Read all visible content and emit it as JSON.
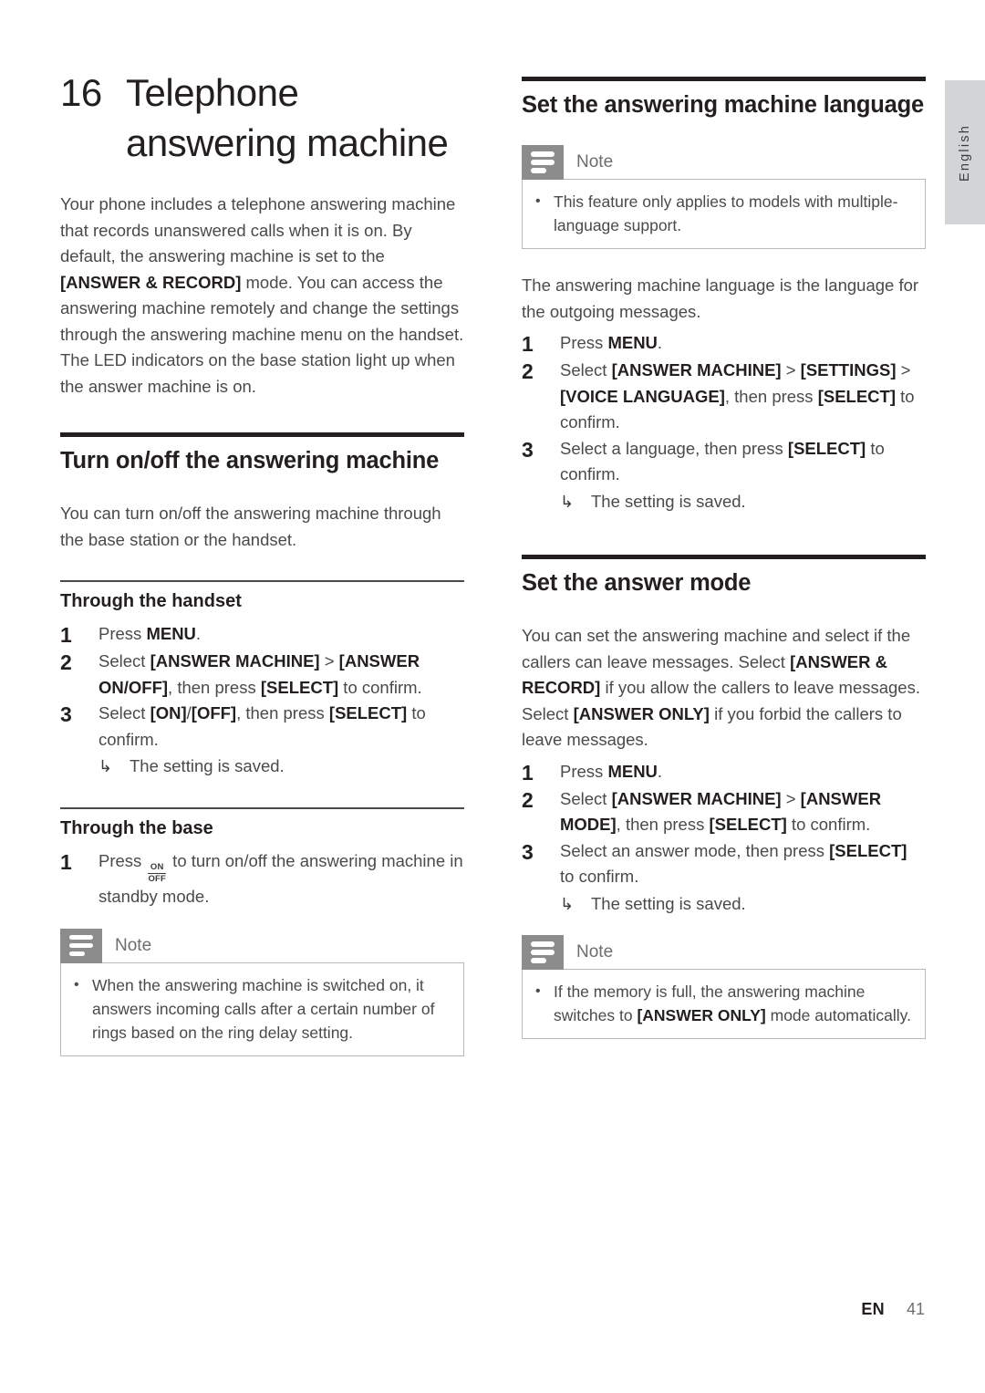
{
  "page": {
    "language_tab": "English",
    "footer": {
      "language_code": "EN",
      "page_number": "41"
    }
  },
  "chapter": {
    "number": "16",
    "title": "Telephone answering machine",
    "intro_1_a": "Your phone includes a telephone answering machine that records unanswered calls when it is on. By default, the answering machine is set to the ",
    "intro_1_kw": "[ANSWER & RECORD]",
    "intro_1_b": " mode. You can access the answering machine remotely and change the settings through the answering machine menu on the handset.",
    "intro_2": "The LED indicators on the base station light up when the answer machine is on."
  },
  "left_column": {
    "section_turn_onoff": {
      "heading": "Turn on/off the answering machine",
      "intro": "You can turn on/off the answering machine through the base station or the handset.",
      "sub_handset": {
        "heading": "Through the handset",
        "steps": [
          {
            "num": "1",
            "parts": [
              {
                "text": "Press ",
                "bold": false
              },
              {
                "text": "MENU",
                "bold": true
              },
              {
                "text": ".",
                "bold": false
              }
            ]
          },
          {
            "num": "2",
            "parts": [
              {
                "text": "Select ",
                "bold": false
              },
              {
                "text": "[ANSWER MACHINE]",
                "bold": true
              },
              {
                "text": " > ",
                "bold": false
              },
              {
                "text": "[ANSWER ON/OFF]",
                "bold": true
              },
              {
                "text": ", then press ",
                "bold": false
              },
              {
                "text": "[SELECT]",
                "bold": true
              },
              {
                "text": " to confirm.",
                "bold": false
              }
            ]
          },
          {
            "num": "3",
            "parts": [
              {
                "text": "Select ",
                "bold": false
              },
              {
                "text": "[ON]",
                "bold": true
              },
              {
                "text": "/",
                "bold": false
              },
              {
                "text": "[OFF]",
                "bold": true
              },
              {
                "text": ", then press ",
                "bold": false
              },
              {
                "text": "[SELECT]",
                "bold": true
              },
              {
                "text": " to confirm.",
                "bold": false
              }
            ],
            "substep": {
              "arrow": "↳",
              "text": "The setting is saved."
            }
          }
        ]
      },
      "sub_base": {
        "heading": "Through the base",
        "step_num": "1",
        "step_prefix": "Press ",
        "onoff_glyph_top": "ON",
        "onoff_glyph_bottom": "OFF",
        "step_suffix": " to turn on/off the answering machine in standby mode."
      },
      "note": {
        "title": "Note",
        "items": [
          "When the answering machine is switched on, it answers incoming calls after a certain number of rings based on the ring delay setting."
        ]
      }
    }
  },
  "right_column": {
    "section_language": {
      "heading": "Set the answering machine language",
      "note": {
        "title": "Note",
        "items": [
          "This feature only applies to models with multiple-language support."
        ]
      },
      "intro": "The answering machine language is the language for the outgoing messages.",
      "steps": [
        {
          "num": "1",
          "parts": [
            {
              "text": "Press ",
              "bold": false
            },
            {
              "text": "MENU",
              "bold": true
            },
            {
              "text": ".",
              "bold": false
            }
          ]
        },
        {
          "num": "2",
          "parts": [
            {
              "text": "Select ",
              "bold": false
            },
            {
              "text": "[ANSWER MACHINE]",
              "bold": true
            },
            {
              "text": " > ",
              "bold": false
            },
            {
              "text": "[SETTINGS]",
              "bold": true
            },
            {
              "text": " > ",
              "bold": false
            },
            {
              "text": "[VOICE LANGUAGE]",
              "bold": true
            },
            {
              "text": ", then press ",
              "bold": false
            },
            {
              "text": "[SELECT]",
              "bold": true
            },
            {
              "text": " to confirm.",
              "bold": false
            }
          ]
        },
        {
          "num": "3",
          "parts": [
            {
              "text": "Select a language, then press ",
              "bold": false
            },
            {
              "text": "[SELECT]",
              "bold": true
            },
            {
              "text": " to confirm.",
              "bold": false
            }
          ],
          "substep": {
            "arrow": "↳",
            "text": "The setting is saved."
          }
        }
      ]
    },
    "section_answer_mode": {
      "heading": "Set the answer mode",
      "intro_parts": [
        {
          "text": "You can set the answering machine and select if the callers can leave messages. Select ",
          "bold": false
        },
        {
          "text": "[ANSWER & RECORD]",
          "bold": true
        },
        {
          "text": " if you allow the callers to leave messages. Select ",
          "bold": false
        },
        {
          "text": "[ANSWER ONLY]",
          "bold": true
        },
        {
          "text": " if you forbid the callers to leave messages.",
          "bold": false
        }
      ],
      "steps": [
        {
          "num": "1",
          "parts": [
            {
              "text": "Press ",
              "bold": false
            },
            {
              "text": "MENU",
              "bold": true
            },
            {
              "text": ".",
              "bold": false
            }
          ]
        },
        {
          "num": "2",
          "parts": [
            {
              "text": "Select ",
              "bold": false
            },
            {
              "text": "[ANSWER MACHINE]",
              "bold": true
            },
            {
              "text": " > ",
              "bold": false
            },
            {
              "text": "[ANSWER MODE]",
              "bold": true
            },
            {
              "text": ", then press ",
              "bold": false
            },
            {
              "text": "[SELECT]",
              "bold": true
            },
            {
              "text": " to confirm.",
              "bold": false
            }
          ]
        },
        {
          "num": "3",
          "parts": [
            {
              "text": "Select an answer mode, then press ",
              "bold": false
            },
            {
              "text": "[SELECT]",
              "bold": true
            },
            {
              "text": " to confirm.",
              "bold": false
            }
          ],
          "substep": {
            "arrow": "↳",
            "text": "The setting is saved."
          }
        }
      ],
      "note": {
        "title": "Note",
        "items_parts": [
          [
            {
              "text": "If the memory is full, the answering machine switches to ",
              "bold": false
            },
            {
              "text": "[ANSWER ONLY]",
              "bold": true
            },
            {
              "text": " mode automatically.",
              "bold": false
            }
          ]
        ]
      }
    }
  }
}
